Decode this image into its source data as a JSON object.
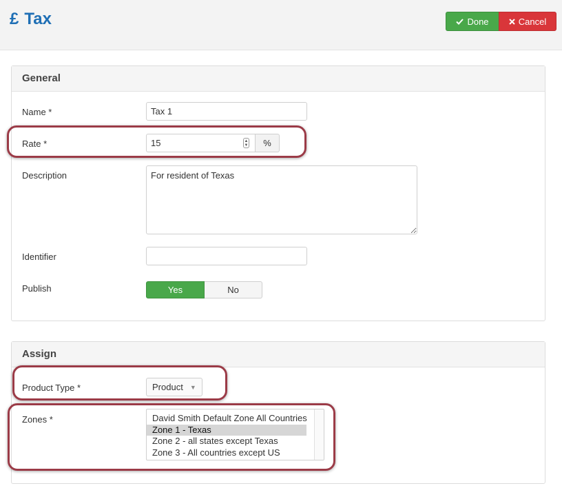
{
  "header": {
    "currency_symbol": "£",
    "title": "Tax",
    "done_label": "Done",
    "cancel_label": "Cancel"
  },
  "general": {
    "heading": "General",
    "name": {
      "label": "Name *",
      "value": "Tax 1"
    },
    "rate": {
      "label": "Rate *",
      "value": "15",
      "unit": "%"
    },
    "description": {
      "label": "Description",
      "value": "For resident of Texas"
    },
    "identifier": {
      "label": "Identifier",
      "value": ""
    },
    "publish": {
      "label": "Publish",
      "yes": "Yes",
      "no": "No",
      "selected": "Yes"
    }
  },
  "assign": {
    "heading": "Assign",
    "product_type": {
      "label": "Product Type *",
      "value": "Product"
    },
    "zones": {
      "label": "Zones *",
      "options": [
        "David Smith Default Zone All Countries",
        "Zone 1 - Texas",
        "Zone 2 - all states except Texas",
        "Zone 3 - All countries except US"
      ],
      "selected": "Zone 1 - Texas"
    }
  },
  "colors": {
    "title": "#1f6fb5",
    "done": "#49a84a",
    "cancel": "#d9363a",
    "highlight": "#9b3b47"
  }
}
